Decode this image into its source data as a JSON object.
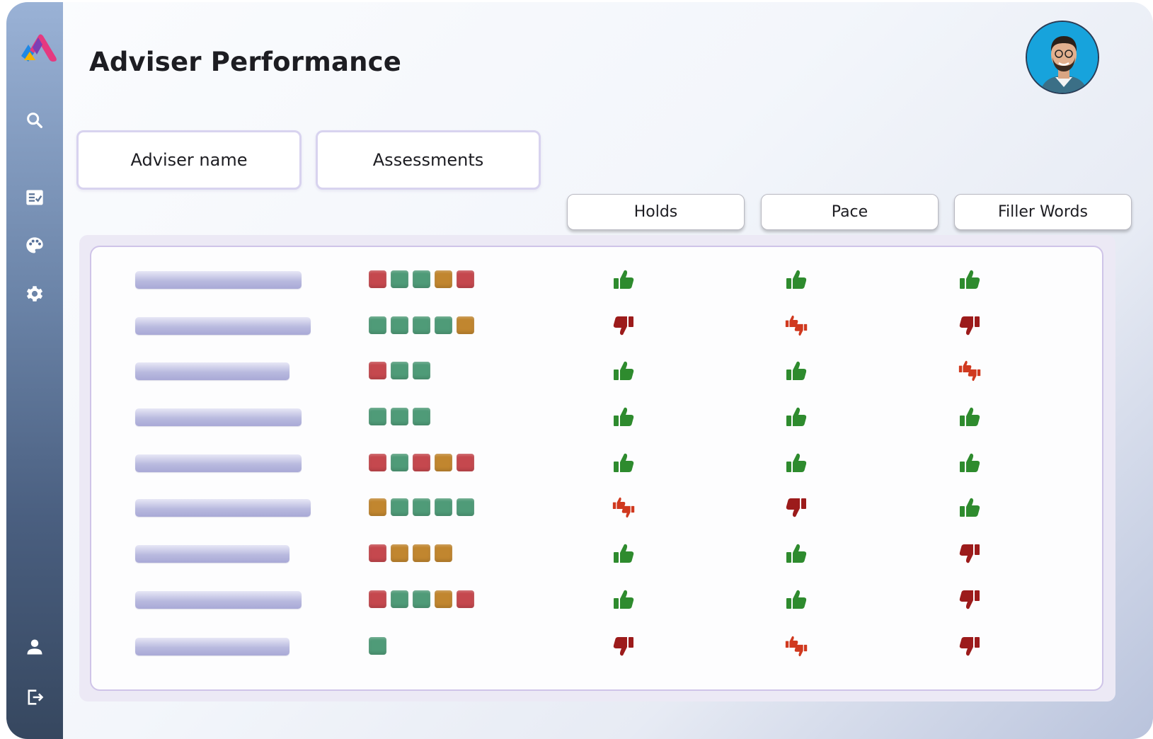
{
  "page": {
    "title": "Adviser Performance"
  },
  "filters": {
    "adviser_name": "Adviser name",
    "assessments": "Assessments"
  },
  "columns": {
    "holds": "Holds",
    "pace": "Pace",
    "filler_words": "Filler Words"
  },
  "sidebar": {
    "items": [
      {
        "icon": "search-icon"
      },
      {
        "icon": "checklist-icon"
      },
      {
        "icon": "palette-icon"
      },
      {
        "icon": "gear-icon"
      },
      {
        "icon": "user-icon"
      },
      {
        "icon": "logout-icon"
      }
    ]
  },
  "colors": {
    "red": "#c5484e",
    "green": "#4f9b78",
    "amber": "#c1862f",
    "thumb_up": "#2e8b2e",
    "thumb_down": "#9c1b1b",
    "thumb_mixed": "#d0391f"
  },
  "rows": [
    {
      "squares": [
        "red",
        "green",
        "green",
        "amber",
        "red"
      ],
      "holds": "up",
      "pace": "up",
      "filler": "up"
    },
    {
      "squares": [
        "green",
        "green",
        "green",
        "green",
        "amber"
      ],
      "holds": "down",
      "pace": "mixed",
      "filler": "down"
    },
    {
      "squares": [
        "red",
        "green",
        "green"
      ],
      "holds": "up",
      "pace": "up",
      "filler": "mixed"
    },
    {
      "squares": [
        "green",
        "green",
        "green"
      ],
      "holds": "up",
      "pace": "up",
      "filler": "up"
    },
    {
      "squares": [
        "red",
        "green",
        "red",
        "amber",
        "red"
      ],
      "holds": "up",
      "pace": "up",
      "filler": "up"
    },
    {
      "squares": [
        "amber",
        "green",
        "green",
        "green",
        "green"
      ],
      "holds": "mixed",
      "pace": "down",
      "filler": "up"
    },
    {
      "squares": [
        "red",
        "amber",
        "amber",
        "amber"
      ],
      "holds": "up",
      "pace": "up",
      "filler": "down"
    },
    {
      "squares": [
        "red",
        "green",
        "green",
        "amber",
        "red"
      ],
      "holds": "up",
      "pace": "up",
      "filler": "down"
    },
    {
      "squares": [
        "green"
      ],
      "holds": "down",
      "pace": "mixed",
      "filler": "down"
    }
  ]
}
